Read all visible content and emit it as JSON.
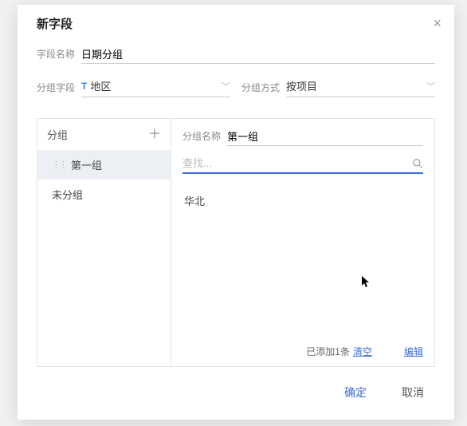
{
  "modal": {
    "title": "新字段",
    "close_icon": "×"
  },
  "form": {
    "name_label": "字段名称",
    "name_value": "日期分组",
    "group_field_label": "分组字段",
    "group_field_type": "T",
    "group_field_value": "地区",
    "group_mode_label": "分组方式",
    "group_mode_value": "按项目"
  },
  "left": {
    "header": "分组",
    "items": [
      {
        "label": "第一组",
        "selected": true,
        "grip": true
      },
      {
        "label": "未分组",
        "selected": false,
        "grip": false
      }
    ]
  },
  "right": {
    "gname_label": "分组名称",
    "gname_value": "第一组",
    "search_placeholder": "查找...",
    "results": [
      "华北"
    ],
    "added_text": "已添加1条",
    "clear_label": "清空",
    "edit_label": "编辑"
  },
  "footer": {
    "ok": "确定",
    "cancel": "取消"
  }
}
